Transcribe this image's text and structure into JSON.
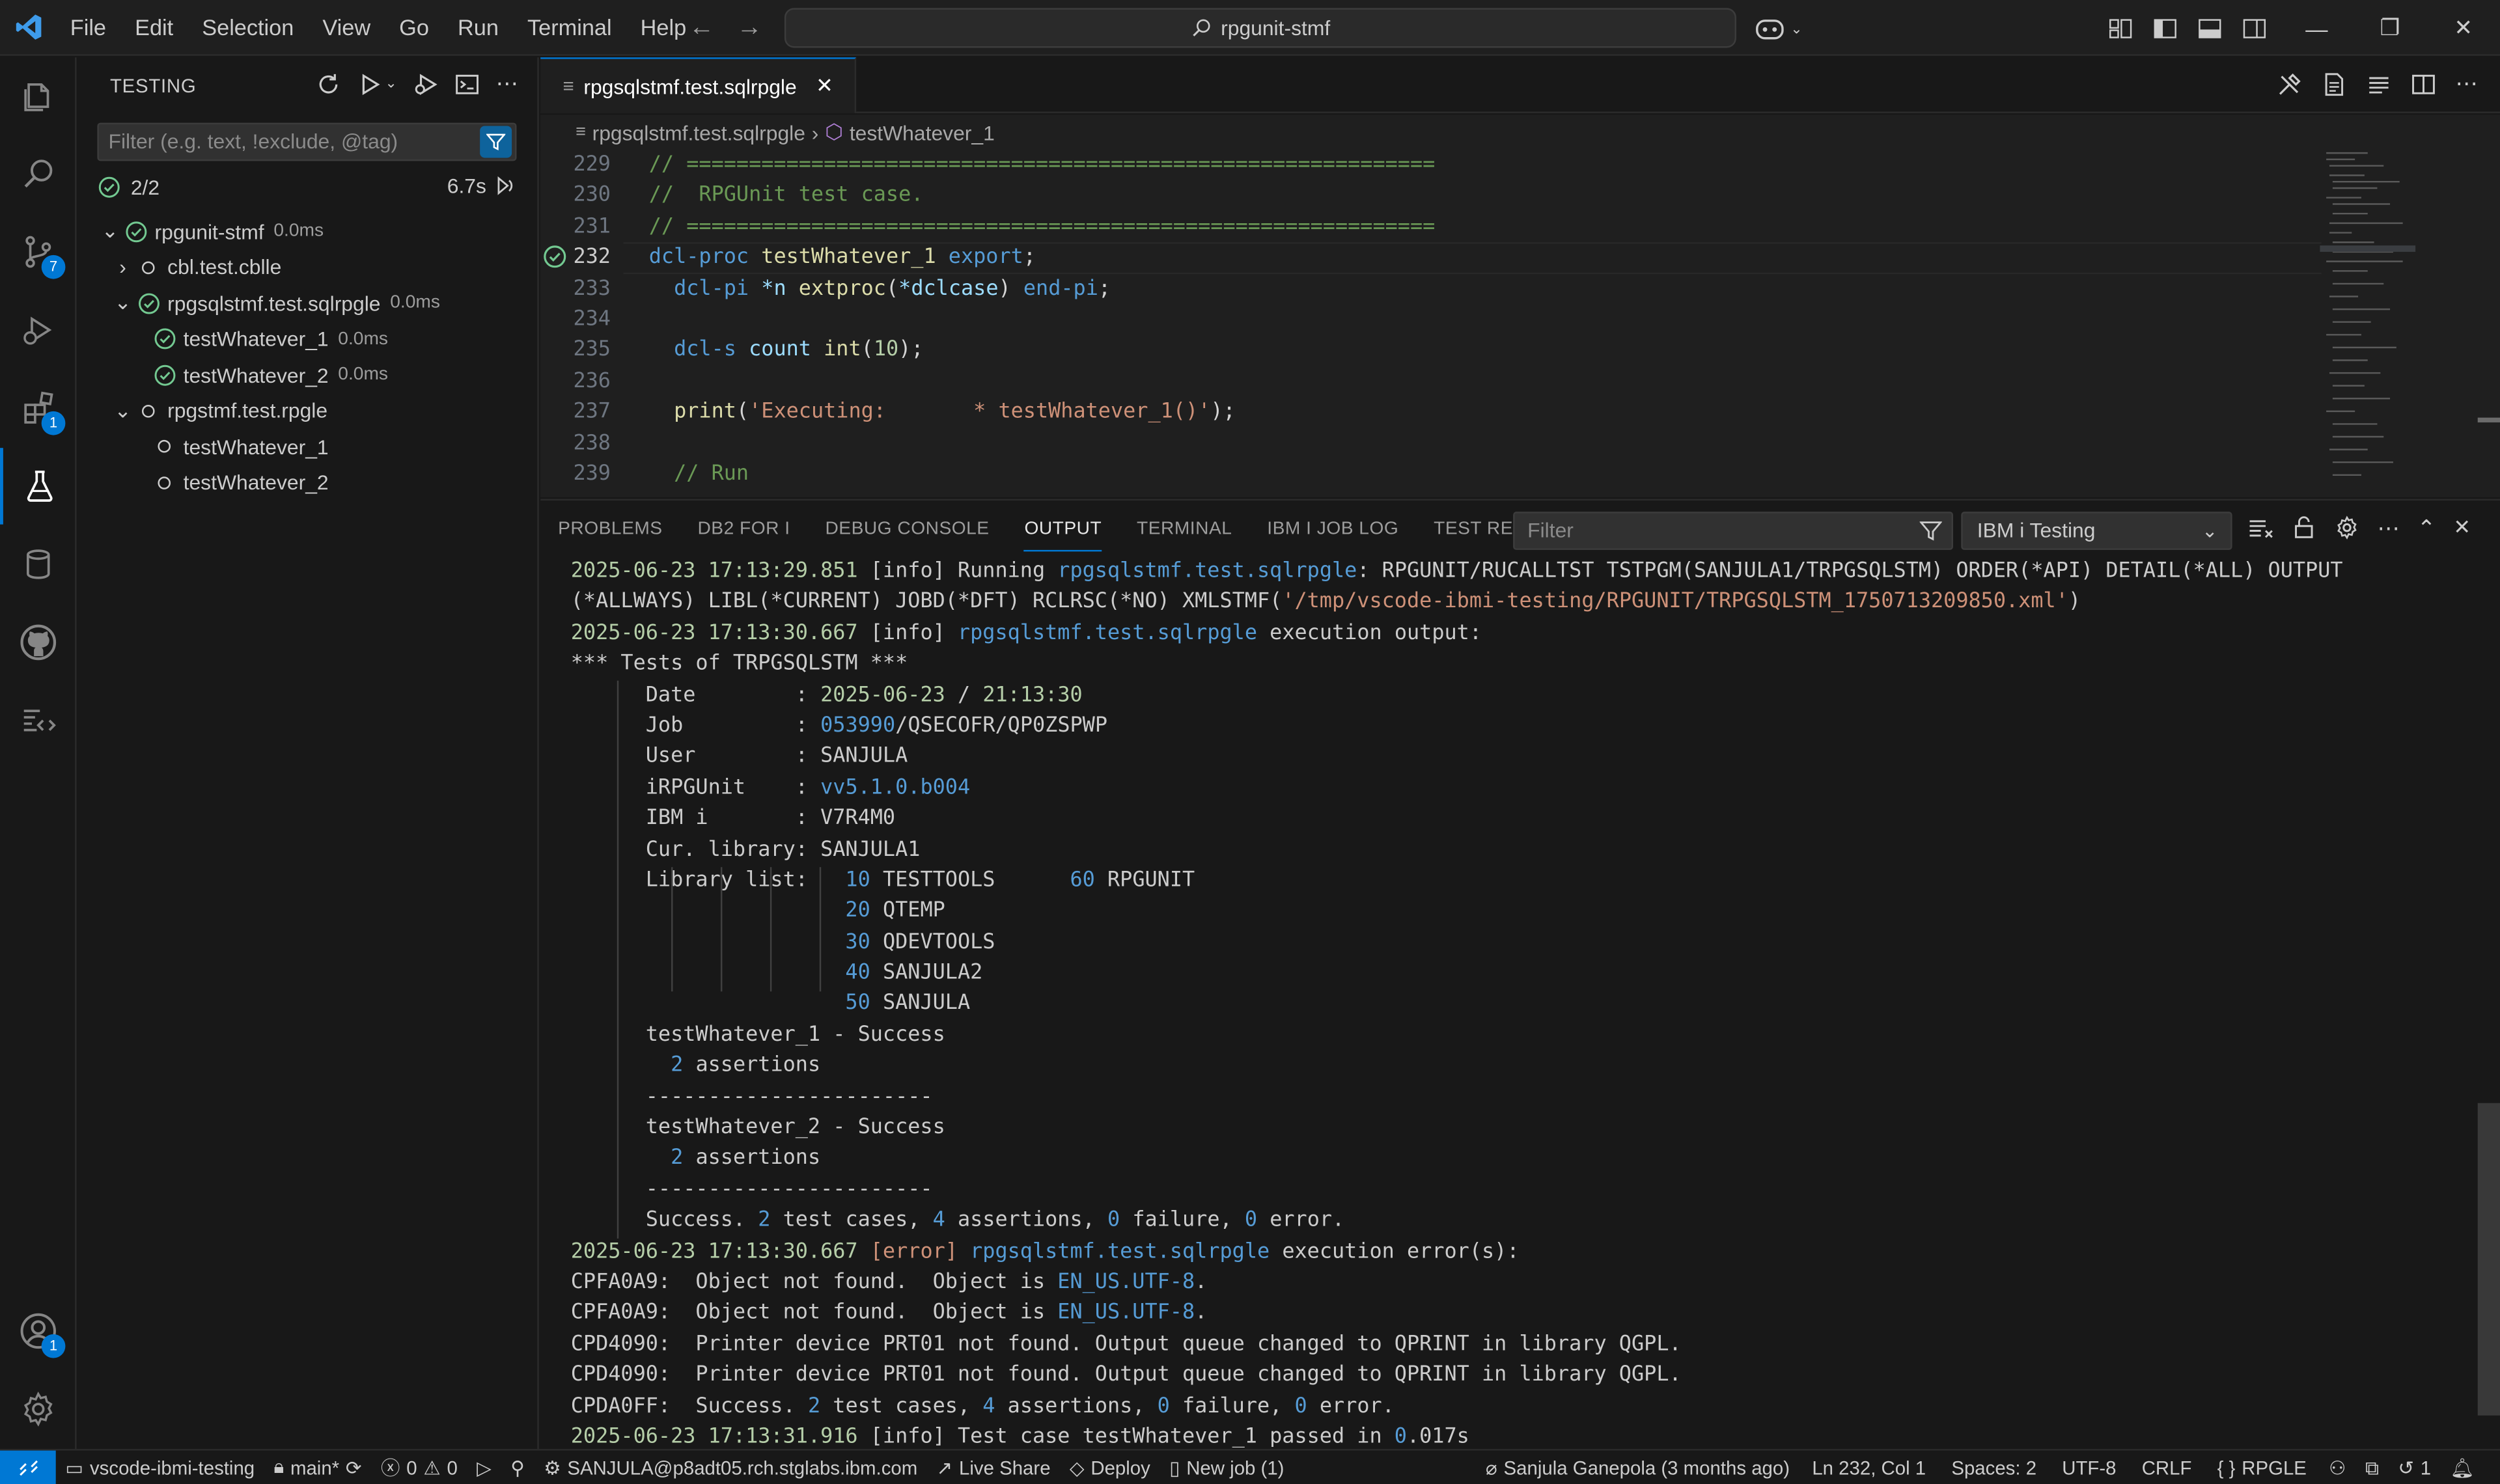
{
  "titlebar": {
    "menu": [
      "File",
      "Edit",
      "Selection",
      "View",
      "Go",
      "Run",
      "Terminal",
      "Help"
    ],
    "search_text": "rpgunit-stmf"
  },
  "activity_badges": {
    "source_control": "7",
    "extensions": "1",
    "accounts": "1"
  },
  "sidebar": {
    "title": "TESTING",
    "filter_placeholder": "Filter (e.g. text, !exclude, @tag)",
    "summary_count": "2/2",
    "summary_duration": "6.7s",
    "tree": [
      {
        "label": "rpgunit-stmf",
        "duration": "0.0ms"
      },
      {
        "label": "cbl.test.cblle",
        "duration": ""
      },
      {
        "label": "rpgsqlstmf.test.sqlrpgle",
        "duration": "0.0ms"
      },
      {
        "label": "testWhatever_1",
        "duration": "0.0ms"
      },
      {
        "label": "testWhatever_2",
        "duration": "0.0ms"
      },
      {
        "label": "rpgstmf.test.rpgle",
        "duration": ""
      },
      {
        "label": "testWhatever_1",
        "duration": ""
      },
      {
        "label": "testWhatever_2",
        "duration": ""
      }
    ]
  },
  "editor": {
    "tab_label": "rpgsqlstmf.test.sqlrpgle",
    "breadcrumb": [
      "rpgsqlstmf.test.sqlrpgle",
      "testWhatever_1"
    ],
    "line_numbers": [
      "229",
      "230",
      "231",
      "232",
      "233",
      "234",
      "235",
      "236",
      "237",
      "238",
      "239"
    ]
  },
  "panel": {
    "tabs": [
      "PROBLEMS",
      "DB2 FOR I",
      "DEBUG CONSOLE",
      "OUTPUT",
      "TERMINAL",
      "IBM I JOB LOG",
      "TEST RESULTS"
    ],
    "active_tab": "OUTPUT",
    "filter_placeholder": "Filter",
    "channel": "IBM i Testing"
  },
  "statusbar": {
    "repo": "vscode-ibmi-testing",
    "branch": "main*",
    "errors": "0",
    "warnings": "0",
    "connection": "SANJULA@p8adt05.rch.stglabs.ibm.com",
    "live_share": "Live Share",
    "deploy": "Deploy",
    "new_job": "New job (1)",
    "blame": "Sanjula Ganepola (3 months ago)",
    "position": "Ln 232, Col 1",
    "spaces": "Spaces: 2",
    "encoding": "UTF-8",
    "eol": "CRLF",
    "language": "RPGLE",
    "history_count": "1"
  },
  "colors": {
    "accent": "#0078d4",
    "pass_green": "#73c991",
    "background": "#181818",
    "editor_bg": "#1f1f1f"
  },
  "icons": {
    "activity": [
      "explorer-icon",
      "search-icon",
      "source-control-icon",
      "run-debug-icon",
      "extensions-icon",
      "testing-icon",
      "database-icon",
      "github-icon",
      "ibmi-icon",
      "accounts-icon",
      "settings-gear-icon"
    ]
  }
}
